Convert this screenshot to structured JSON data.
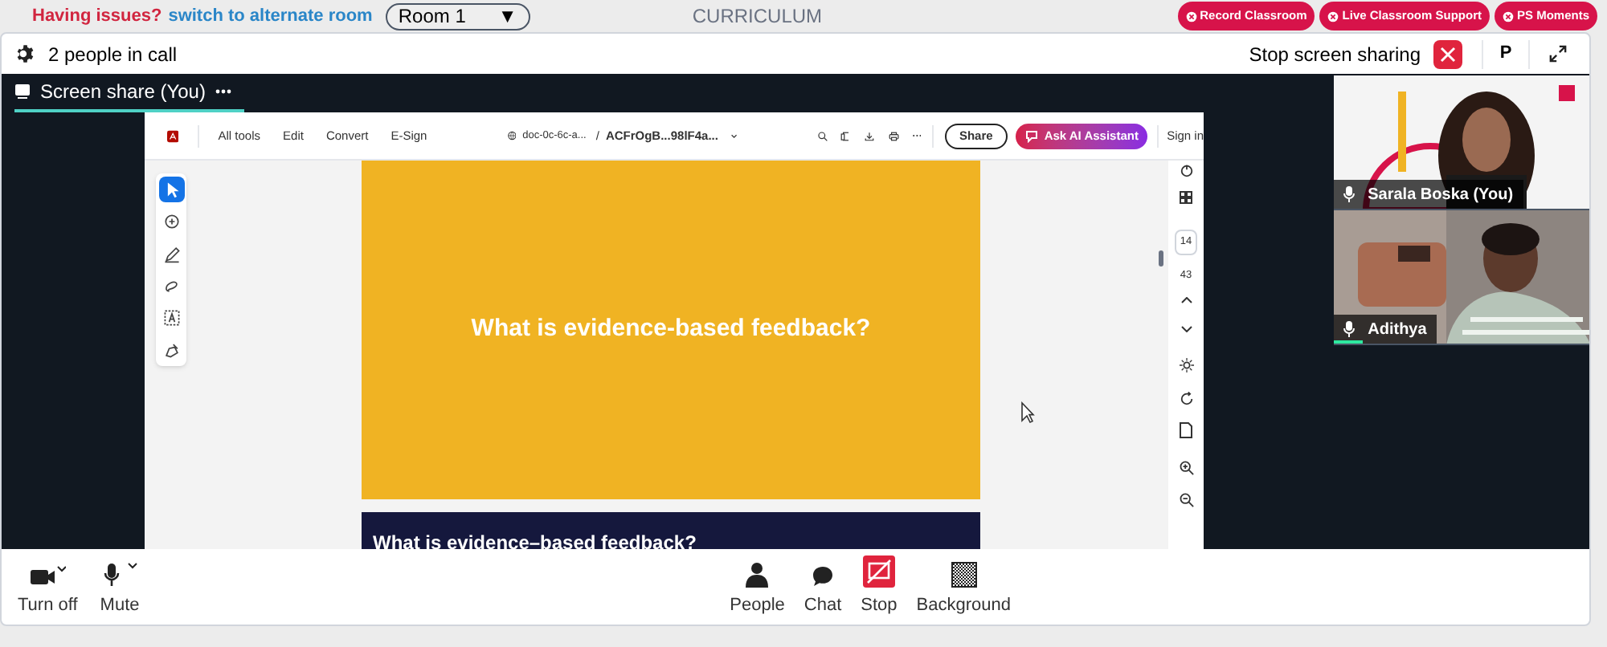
{
  "top_bar": {
    "issue_text": "Having issues?",
    "alternate_link": "switch to alternate room",
    "room_select": "Room 1",
    "room_caret": "▼",
    "title": "CURRICULUM",
    "buttons": [
      "Record Classroom",
      "Live Classroom Support",
      "PS Moments"
    ]
  },
  "call_header": {
    "people_count": "2 people in call",
    "stop_sharing": "Stop screen sharing",
    "avatar_letter": "P"
  },
  "screen_share_tab": {
    "label": "Screen share (You)"
  },
  "pdf_viewer": {
    "menu": [
      "All tools",
      "Edit",
      "Convert",
      "E-Sign"
    ],
    "doc_path": "doc-0c-6c-a...",
    "separator": "/",
    "doc_name": "ACFrOgB...98lF4a...",
    "share": "Share",
    "ai_assistant": "Ask AI Assistant",
    "sign_in": "Sign in",
    "tools": [
      {
        "kind": "select",
        "selected": true
      },
      {
        "kind": "comment",
        "selected": false
      },
      {
        "kind": "draw",
        "selected": false
      },
      {
        "kind": "lasso",
        "selected": false
      },
      {
        "kind": "text",
        "selected": false
      },
      {
        "kind": "sign",
        "selected": false
      }
    ],
    "pages": [
      {
        "kind": "light",
        "title": "What is evidence-based feedback?"
      },
      {
        "kind": "dark",
        "title": "What is evidence–based feedback?"
      }
    ],
    "current_page": "14",
    "total_pages": "43"
  },
  "participants": [
    {
      "name": "Sarala Boska (You)",
      "speaking": false
    },
    {
      "name": "Adithya",
      "speaking": true
    }
  ],
  "controls_left": [
    {
      "kind": "camera",
      "label": "Turn off"
    },
    {
      "kind": "mic",
      "label": "Mute"
    }
  ],
  "controls_center": [
    {
      "kind": "people",
      "label": "People"
    },
    {
      "kind": "chat",
      "label": "Chat"
    },
    {
      "kind": "stop",
      "label": "Stop"
    },
    {
      "kind": "background",
      "label": "Background"
    }
  ]
}
